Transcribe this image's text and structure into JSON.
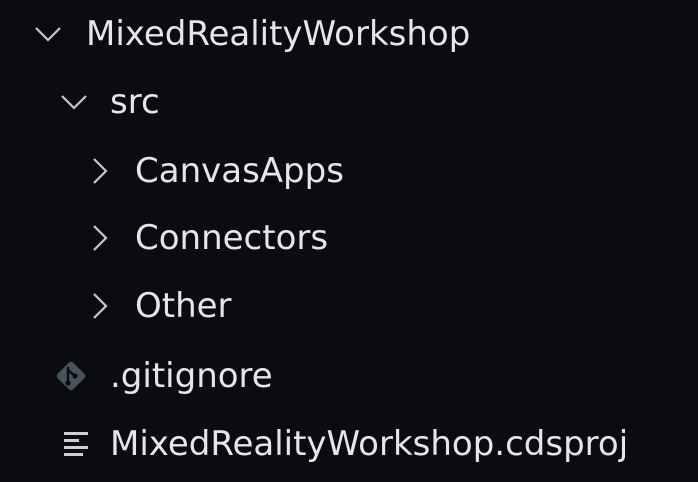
{
  "explorer": {
    "root": {
      "label": "MixedRealityWorkshop",
      "icon": "chevron-down-icon"
    },
    "src": {
      "label": "src",
      "icon": "chevron-down-icon"
    },
    "folders": [
      {
        "label": "CanvasApps",
        "icon": "chevron-right-icon"
      },
      {
        "label": "Connectors",
        "icon": "chevron-right-icon"
      },
      {
        "label": "Other",
        "icon": "chevron-right-icon"
      }
    ],
    "files": [
      {
        "label": ".gitignore",
        "icon": "git-icon"
      },
      {
        "label": "MixedRealityWorkshop.cdsproj",
        "icon": "text-lines-icon"
      }
    ]
  },
  "colors": {
    "background": "#0b0b12",
    "text": "#e6e6e6",
    "git_icon": "#47525a",
    "chevron": "#c8c8c8"
  }
}
